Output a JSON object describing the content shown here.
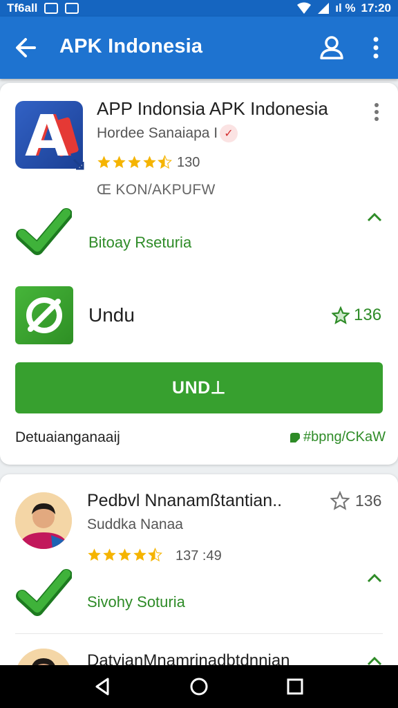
{
  "status_bar": {
    "left_text": "Tf6all",
    "right_text": "17:20",
    "signal_text": "ıl %"
  },
  "app_bar": {
    "title": "APK Indonesia",
    "back_icon": "arrow-left-icon",
    "account_icon": "person-icon",
    "more_icon": "more-vert-icon",
    "color": "#1e73d0"
  },
  "card1": {
    "app_title": "APP Indonsia APK Indonesia",
    "developer": "Hordee Sanaiapa I",
    "rating": 4.5,
    "rating_count": "130",
    "package": "Œ KON/AKPUFW",
    "status_link": "Bitoay Rseturia",
    "download_label": "Undu",
    "fav_count": "136",
    "install_button": "UND⊥",
    "description": "Detuaianganaaij",
    "tag_link": "#bpng/CKaW"
  },
  "card2": {
    "title": "Pedbvl Nnanamßtantian..",
    "subtitle": "Suddka Nanaa",
    "star_count": "136",
    "rating": 4.5,
    "rating_count": "137 :49",
    "status_link": "Sivohy Soturia",
    "next_title": "DatyianMnamrinadbtdnnian"
  },
  "colors": {
    "accent_green": "#37a02f",
    "link_green": "#2e8b27",
    "star_gold": "#f5b400"
  }
}
